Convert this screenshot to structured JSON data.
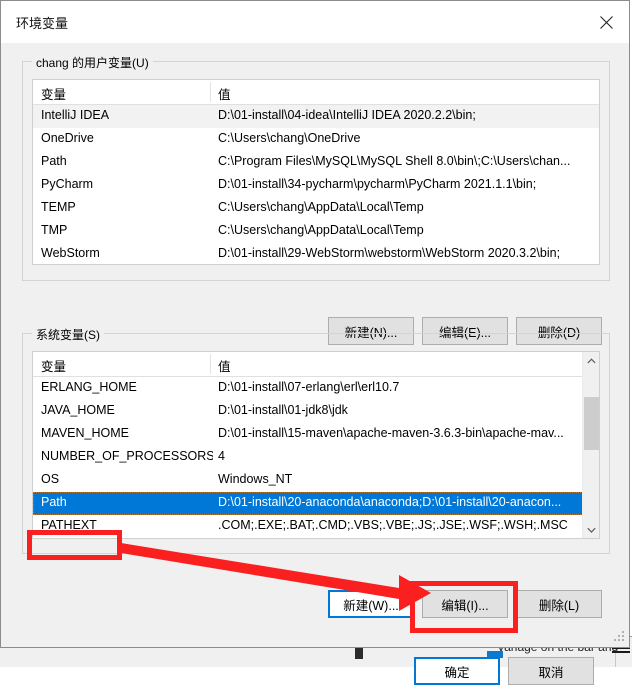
{
  "window": {
    "title": "环境变量",
    "close_icon": "close-icon"
  },
  "user_section": {
    "caption": "chang 的用户变量(U)",
    "columns": [
      "变量",
      "值"
    ],
    "rows": [
      {
        "name": "IntelliJ IDEA",
        "value": "D:\\01-install\\04-idea\\IntelliJ IDEA 2020.2.2\\bin;"
      },
      {
        "name": "OneDrive",
        "value": "C:\\Users\\chang\\OneDrive"
      },
      {
        "name": "Path",
        "value": "C:\\Program Files\\MySQL\\MySQL Shell 8.0\\bin\\;C:\\Users\\chan..."
      },
      {
        "name": "PyCharm",
        "value": "D:\\01-install\\34-pycharm\\pycharm\\PyCharm 2021.1.1\\bin;"
      },
      {
        "name": "TEMP",
        "value": "C:\\Users\\chang\\AppData\\Local\\Temp"
      },
      {
        "name": "TMP",
        "value": "C:\\Users\\chang\\AppData\\Local\\Temp"
      },
      {
        "name": "WebStorm",
        "value": "D:\\01-install\\29-WebStorm\\webstorm\\WebStorm 2020.3.2\\bin;"
      }
    ],
    "buttons": {
      "new": "新建(N)...",
      "edit": "编辑(E)...",
      "delete": "删除(D)"
    }
  },
  "system_section": {
    "caption": "系统变量(S)",
    "columns": [
      "变量",
      "值"
    ],
    "rows": [
      {
        "name": "ERLANG_HOME",
        "value": "D:\\01-install\\07-erlang\\erl\\erl10.7"
      },
      {
        "name": "JAVA_HOME",
        "value": "D:\\01-install\\01-jdk8\\jdk"
      },
      {
        "name": "MAVEN_HOME",
        "value": "D:\\01-install\\15-maven\\apache-maven-3.6.3-bin\\apache-mav..."
      },
      {
        "name": "NUMBER_OF_PROCESSORS",
        "value": "4"
      },
      {
        "name": "OS",
        "value": "Windows_NT"
      },
      {
        "name": "Path",
        "value": "D:\\01-install\\20-anaconda\\anaconda;D:\\01-install\\20-anacon..."
      },
      {
        "name": "PATHEXT",
        "value": ".COM;.EXE;.BAT;.CMD;.VBS;.VBE;.JS;.JSE;.WSF;.WSH;.MSC"
      }
    ],
    "selected_row_index": 5,
    "scrollbar": {
      "up_icon": "chevron-up-icon",
      "down_icon": "chevron-down-icon"
    },
    "buttons": {
      "new": "新建(W)...",
      "edit": "编辑(I)...",
      "delete": "删除(L)"
    }
  },
  "footer": {
    "ok": "确定",
    "cancel": "取消"
  },
  "annotations": {
    "color": "#fb2020",
    "path_box": "highlight-path-row",
    "edit_box": "highlight-edit-button",
    "arrow": "arrow-path-to-edit"
  },
  "background_window": {
    "text": "Variage on the bar and"
  },
  "colors": {
    "selection_blue": "#0078d7",
    "focus_blue": "#0078d7",
    "annotation_red": "#fb2020",
    "dialog_bg": "#f0f0f0"
  }
}
